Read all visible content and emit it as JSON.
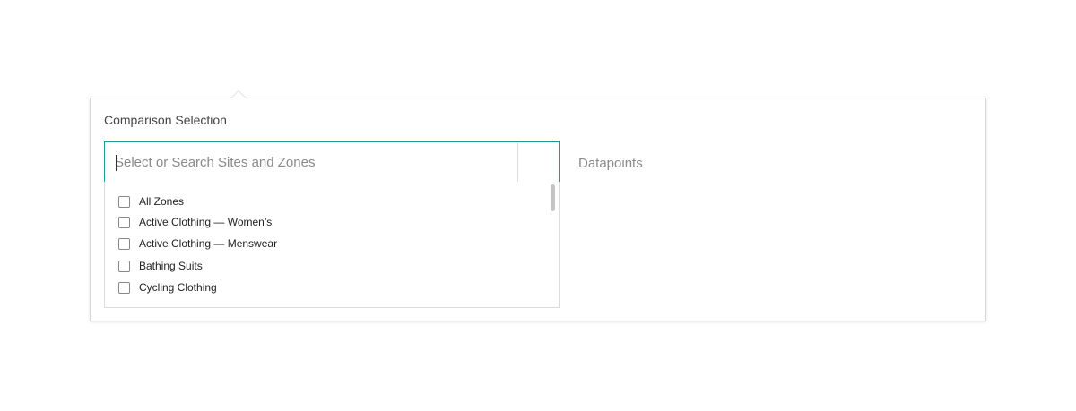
{
  "popover": {
    "title": "Comparison Selection"
  },
  "search": {
    "placeholder": "Select or Search Sites and Zones",
    "value": ""
  },
  "datapoints": {
    "label": "Datapoints"
  },
  "options": [
    {
      "label": "All Zones",
      "checked": false
    },
    {
      "label": "Active Clothing — Women’s",
      "checked": false
    },
    {
      "label": "Active Clothing — Menswear",
      "checked": false
    },
    {
      "label": "Bathing Suits",
      "checked": false
    },
    {
      "label": "Cycling Clothing",
      "checked": false
    }
  ],
  "colors": {
    "accent": "#1d9a91",
    "border": "#d6d6d6",
    "placeholder": "#8a8a8a",
    "text": "#222222"
  }
}
